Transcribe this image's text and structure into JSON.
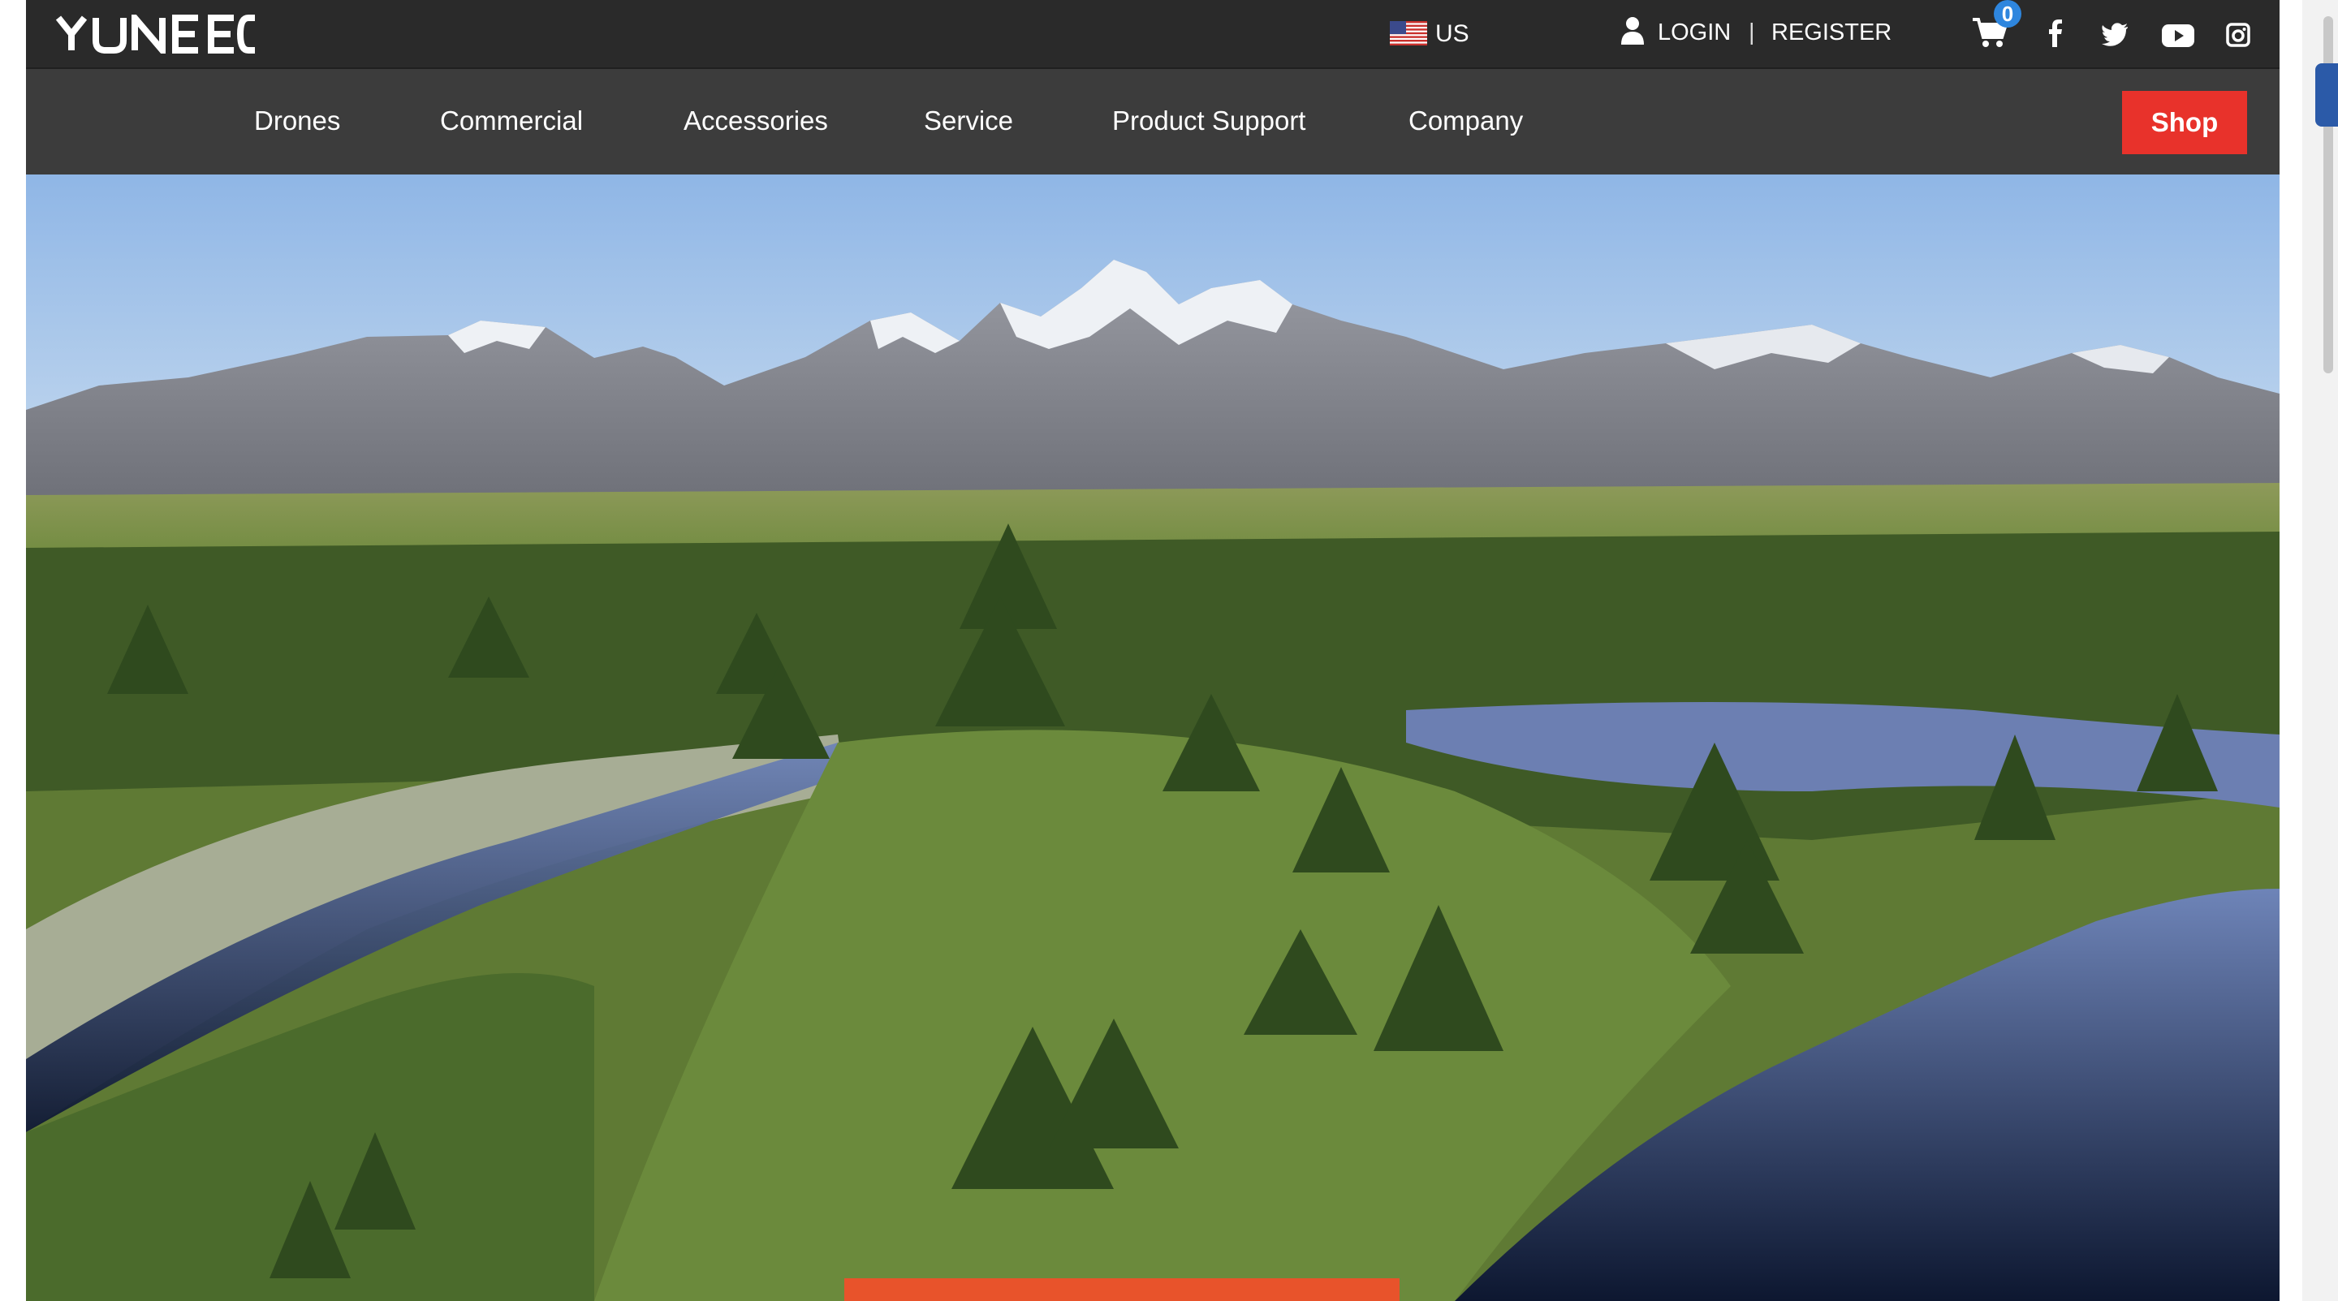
{
  "brand": {
    "logo_text": "YUNEEC"
  },
  "topbar": {
    "region": "US",
    "login_label": "LOGIN",
    "separator": "|",
    "register_label": "REGISTER",
    "cart_count": "0",
    "social_icons": [
      "facebook-icon",
      "twitter-icon",
      "youtube-icon",
      "instagram-icon"
    ]
  },
  "nav": {
    "items": [
      {
        "label": "Drones"
      },
      {
        "label": "Commercial"
      },
      {
        "label": "Accessories"
      },
      {
        "label": "Service"
      },
      {
        "label": "Product Support"
      },
      {
        "label": "Company"
      }
    ],
    "shop_label": "Shop"
  },
  "colors": {
    "topbar_bg": "#2a2a2a",
    "navbar_bg": "#3c3c3c",
    "shop_red": "#e8322b",
    "cart_badge_blue": "#2e86de",
    "cta_orange": "#e8532b"
  }
}
